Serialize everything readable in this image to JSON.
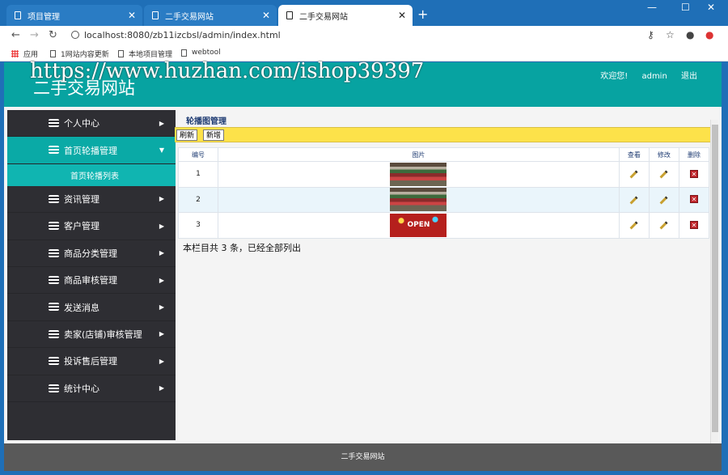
{
  "browser": {
    "tabs": [
      {
        "title": "项目管理",
        "active": false
      },
      {
        "title": "二手交易网站",
        "active": false
      },
      {
        "title": "二手交易网站",
        "active": true
      }
    ],
    "url": "localhost:8080/zb11izcbsl/admin/index.html",
    "bookmarks": [
      "应用",
      "1网站内容更新",
      "本地项目管理",
      "webtool"
    ]
  },
  "header": {
    "watermark": "https://www.huzhan.com/ishop39397",
    "site_title": "二手交易网站",
    "welcome": "欢迎您!",
    "user": "admin",
    "logout": "退出"
  },
  "sidebar": {
    "items": [
      {
        "label": "个人中心",
        "expanded": false
      },
      {
        "label": "首页轮播管理",
        "expanded": true,
        "sub": [
          "首页轮播列表"
        ]
      },
      {
        "label": "资讯管理",
        "expanded": false
      },
      {
        "label": "客户管理",
        "expanded": false
      },
      {
        "label": "商品分类管理",
        "expanded": false
      },
      {
        "label": "商品审核管理",
        "expanded": false
      },
      {
        "label": "发送消息",
        "expanded": false
      },
      {
        "label": "卖家(店铺)审核管理",
        "expanded": false
      },
      {
        "label": "投诉售后管理",
        "expanded": false
      },
      {
        "label": "统计中心",
        "expanded": false
      }
    ]
  },
  "content": {
    "breadcrumb": "轮播图管理",
    "toolbar": {
      "refresh": "刷新",
      "add": "新增"
    },
    "table": {
      "headers": [
        "编号",
        "图片",
        "查看",
        "修改",
        "删除"
      ],
      "rows": [
        {
          "id": "1",
          "image": "market-photo"
        },
        {
          "id": "2",
          "image": "market-photo"
        },
        {
          "id": "3",
          "image": "open-banner",
          "image_text": "OPEN"
        }
      ]
    },
    "summary": "本栏目共 3 条，已经全部列出"
  },
  "footer": {
    "text": "二手交易网站"
  }
}
